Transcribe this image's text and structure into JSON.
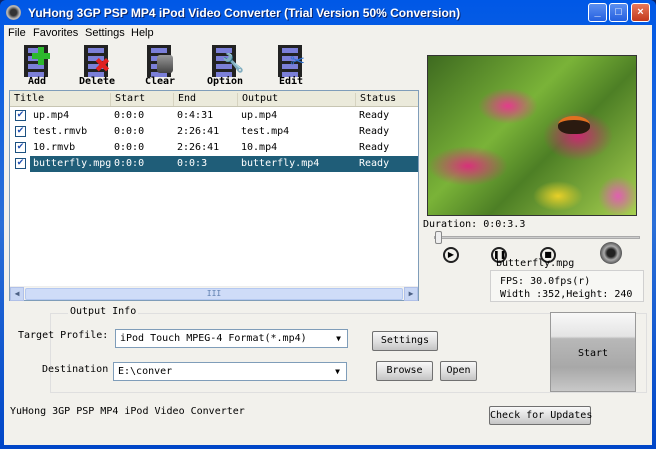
{
  "window": {
    "title": "YuHong 3GP PSP MP4 iPod Video Converter (Trial Version 50% Conversion)",
    "controls": [
      "_",
      "□",
      "×"
    ]
  },
  "menu": [
    "File",
    "Favorites",
    "Settings",
    "Help"
  ],
  "toolbar": [
    {
      "label": "Add",
      "icon": "add-icon"
    },
    {
      "label": "Delete",
      "icon": "delete-icon"
    },
    {
      "label": "Clear",
      "icon": "clear-icon"
    },
    {
      "label": "Option",
      "icon": "option-icon"
    },
    {
      "label": "Edit",
      "icon": "edit-icon"
    }
  ],
  "table": {
    "columns": [
      "Title",
      "Start",
      "End",
      "Output",
      "Status"
    ],
    "rows": [
      {
        "checked": true,
        "title": "up.mp4",
        "start": "0:0:0",
        "end": "0:4:31",
        "output": "up.mp4",
        "status": "Ready"
      },
      {
        "checked": true,
        "title": "test.rmvb",
        "start": "0:0:0",
        "end": "2:26:41",
        "output": "test.mp4",
        "status": "Ready"
      },
      {
        "checked": true,
        "title": "10.rmvb",
        "start": "0:0:0",
        "end": "2:26:41",
        "output": "10.mp4",
        "status": "Ready"
      },
      {
        "checked": true,
        "title": "butterfly.mpg",
        "start": "0:0:0",
        "end": "0:0:3",
        "output": "butterfly.mp4",
        "status": "Ready",
        "selected": true
      }
    ],
    "scroll_thumb": "III"
  },
  "player": {
    "duration": "Duration: 0:0:3.3",
    "seek_fraction": 0,
    "file": "butterfly.mpg",
    "fps": "FPS: 30.0fps(r)",
    "size": "Width :352,Height: 240"
  },
  "output": {
    "group_label": "Output Info",
    "target_label": "Target Profile:",
    "target_value": "iPod Touch  MPEG-4  Format(*.mp4)",
    "settings": "Settings",
    "dest_label": "Destination",
    "dest_value": "E:\\conver",
    "browse": "Browse",
    "open": "Open",
    "start": "Start"
  },
  "footer": {
    "app_name": "YuHong 3GP PSP MP4 iPod Video Converter",
    "updates": "Check for Updates"
  }
}
